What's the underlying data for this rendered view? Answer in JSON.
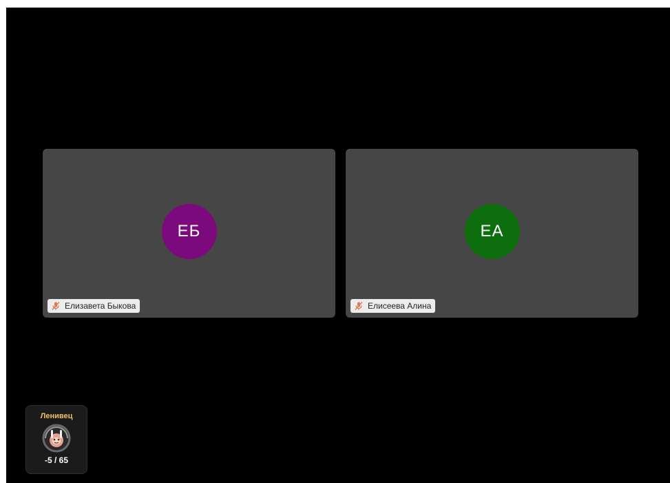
{
  "participants": [
    {
      "initials": "ЕБ",
      "name": "Елизавета Быкова",
      "avatar_color": "#7c0a7c",
      "mic_icon": "mic-muted-icon",
      "mic_color": "#e07a52"
    },
    {
      "initials": "ЕА",
      "name": "Елисеева Алина",
      "avatar_color": "#0c6e0c",
      "mic_icon": "mic-muted-icon",
      "mic_color": "#e07a52"
    }
  ],
  "status_widget": {
    "title": "Ленивец",
    "emblem_icon": "sloth-icon",
    "score": "-5 / 65",
    "title_color": "#f0c060"
  },
  "colors": {
    "stage_background": "#000000",
    "tile_background": "#464646",
    "name_tag_background": "#ececec"
  }
}
